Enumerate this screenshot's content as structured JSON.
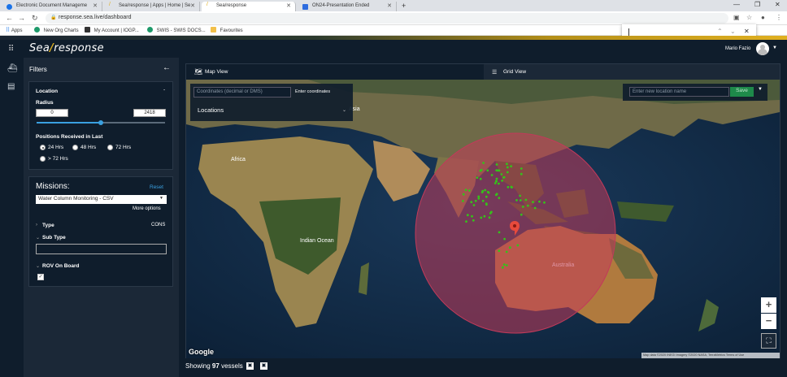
{
  "browser": {
    "tabs": [
      {
        "title": "Electronic Document Manageme",
        "favicon_color": "#1a73e8"
      },
      {
        "title": "Sea/response | Apps | Home | Se",
        "favicon_color": "#e0b020"
      },
      {
        "title": "Sea/response",
        "favicon_color": "#e0b020"
      },
      {
        "title": "ON24-Presentation Ended",
        "favicon_color": "#2d6cdf"
      }
    ],
    "url": "response.sea.live/dashboard",
    "bookmarks": [
      "Apps",
      "New Org Charts",
      "My Account | IOGP...",
      "SWIS - SWIS DOCS...",
      "Favourites"
    ],
    "find_value": ""
  },
  "app": {
    "logo_left": "Sea",
    "logo_slash": "/",
    "logo_right": "response",
    "username": "Mario Fazio"
  },
  "filters": {
    "title": "Filters",
    "location": {
      "heading": "Location",
      "collapse": "-",
      "radius_label": "Radius",
      "radius_min": "0",
      "radius_max": "2418",
      "radius_fill_fraction": 0.5,
      "positions_label": "Positions Received in Last",
      "options": [
        "24 Hrs",
        "48 Hrs",
        "72 Hrs",
        "> 72 Hrs"
      ],
      "selected": "24 Hrs"
    },
    "missions": {
      "heading": "Missions:",
      "reset": "Reset",
      "selected": "Water Column Monitoring - CSV",
      "more_options": "More options",
      "type_label": "Type",
      "type_value": "CONS",
      "subtype_label": "Sub Type",
      "subtype_value": "",
      "rov_label": "ROV On Board",
      "rov_checked": true
    }
  },
  "map": {
    "tabs": [
      "Map View",
      "Grid View"
    ],
    "active_tab": "Map View",
    "coord_placeholder": "Coordinates (decimal or DMS)",
    "coord_button": "Enter coordinates",
    "locations_label": "Locations",
    "new_location_placeholder": "Enter new location name",
    "save_label": "Save",
    "zoom_in": "+",
    "zoom_out": "−",
    "google": "Google",
    "attribution": "Map data ©2020 INEGI Imagery ©2020 NASA, TerraMetrics   Terms of Use"
  },
  "footer": {
    "showing_prefix": "Showing",
    "vessel_count": "97",
    "showing_suffix": "vessels"
  },
  "colors": {
    "accent_gold": "#e0b020",
    "panel_bg": "#1b2837",
    "app_bg": "#0f1d2c",
    "radius_circle": "#c23a5a",
    "vessel_marker": "#35c21a",
    "pin": "#e84a3c",
    "save_green": "#1e8a4a"
  }
}
